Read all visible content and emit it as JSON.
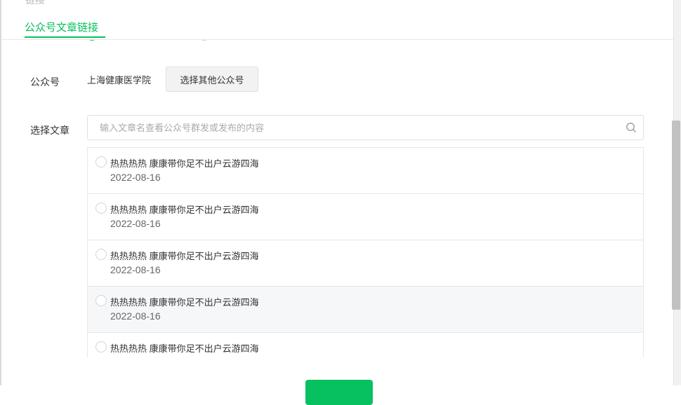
{
  "header": {
    "clipped_text": "链接",
    "active_tab": "公众号文章链接"
  },
  "form": {
    "account_label": "公众号",
    "account_name": "上海健康医学院",
    "choose_other_button": "选择其他公众号",
    "article_label": "选择文章",
    "search_placeholder": "输入文章名查看公众号群发或发布的内容"
  },
  "articles": [
    {
      "title": "热热热热 康康带你足不出户云游四海",
      "date": "2022-08-16"
    },
    {
      "title": "热热热热 康康带你足不出户云游四海",
      "date": "2022-08-16"
    },
    {
      "title": "热热热热 康康带你足不出户云游四海",
      "date": "2022-08-16"
    },
    {
      "title": "热热热热 康康带你足不出户云游四海",
      "date": "2022-08-16"
    },
    {
      "title": "热热热热 康康带你足不出户云游四海",
      "date": ""
    }
  ],
  "colors": {
    "accent": "#07c160",
    "border": "#e7e7e7",
    "hover_row": "#f6f7f8"
  },
  "icons": {
    "search": "search-icon"
  }
}
